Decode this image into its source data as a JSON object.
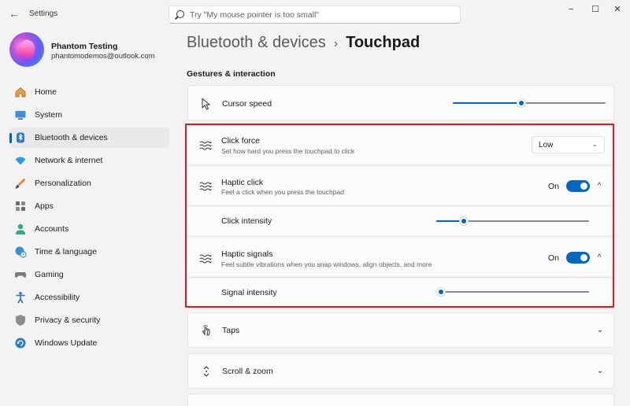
{
  "window": {
    "app_title": "Settings",
    "minimize": "−",
    "maximize": "☐",
    "close": "✕"
  },
  "search": {
    "placeholder": "Try \"My mouse pointer is too small\""
  },
  "profile": {
    "name": "Phantom Testing",
    "email": "phantomodemos@outlook.com"
  },
  "sidebar": {
    "items": [
      {
        "label": "Home",
        "icon": "home-icon"
      },
      {
        "label": "System",
        "icon": "system-icon"
      },
      {
        "label": "Bluetooth & devices",
        "icon": "bluetooth-icon",
        "active": true
      },
      {
        "label": "Network & internet",
        "icon": "wifi-icon"
      },
      {
        "label": "Personalization",
        "icon": "brush-icon"
      },
      {
        "label": "Apps",
        "icon": "apps-icon"
      },
      {
        "label": "Accounts",
        "icon": "person-icon"
      },
      {
        "label": "Time & language",
        "icon": "globe-clock-icon"
      },
      {
        "label": "Gaming",
        "icon": "controller-icon"
      },
      {
        "label": "Accessibility",
        "icon": "accessibility-icon"
      },
      {
        "label": "Privacy & security",
        "icon": "shield-icon"
      },
      {
        "label": "Windows Update",
        "icon": "update-icon"
      }
    ]
  },
  "breadcrumb": {
    "parent": "Bluetooth & devices",
    "separator": "›",
    "current": "Touchpad"
  },
  "section": {
    "title": "Gestures & interaction"
  },
  "settings": {
    "cursor_speed": {
      "title": "Cursor speed",
      "level": 0.45
    },
    "click_force": {
      "title": "Click force",
      "subtitle": "Set how hard you press the touchpad to click",
      "value": "Low"
    },
    "haptic_click": {
      "title": "Haptic click",
      "subtitle": "Feel a click when you press the touchpad",
      "state": "On"
    },
    "click_intensity": {
      "title": "Click intensity",
      "level": 0.18
    },
    "haptic_signals": {
      "title": "Haptic signals",
      "subtitle": "Feel subtle vibrations when you snap windows, align objects, and more",
      "state": "On"
    },
    "signal_intensity": {
      "title": "Signal intensity",
      "level": 0.0
    },
    "taps": {
      "title": "Taps"
    },
    "scroll_zoom": {
      "title": "Scroll & zoom"
    }
  },
  "colors": {
    "accent": "#0067c0",
    "highlight_border": "#d81b24"
  }
}
